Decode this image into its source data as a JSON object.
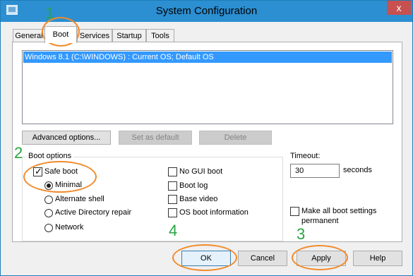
{
  "window": {
    "title": "System Configuration",
    "close_glyph": "x"
  },
  "tabs": [
    {
      "label": "General",
      "active": false
    },
    {
      "label": "Boot",
      "active": true
    },
    {
      "label": "Services",
      "active": false
    },
    {
      "label": "Startup",
      "active": false
    },
    {
      "label": "Tools",
      "active": false
    }
  ],
  "os_list": {
    "items": [
      "Windows 8.1 (C:\\WINDOWS) : Current OS; Default OS"
    ]
  },
  "os_buttons": {
    "advanced": "Advanced options...",
    "set_default": "Set as default",
    "delete": "Delete"
  },
  "boot_options": {
    "label": "Boot options",
    "safe_boot": "Safe boot",
    "minimal": "Minimal",
    "alternate_shell": "Alternate shell",
    "ad_repair": "Active Directory repair",
    "network": "Network",
    "no_gui": "No GUI boot",
    "boot_log": "Boot log",
    "base_video": "Base video",
    "os_boot_info": "OS boot information"
  },
  "timeout": {
    "label": "Timeout:",
    "value": "30",
    "units": "seconds"
  },
  "permanent": {
    "line1": "Make all boot settings",
    "line2": "permanent"
  },
  "footer": {
    "ok": "OK",
    "cancel": "Cancel",
    "apply": "Apply",
    "help": "Help"
  },
  "annotations": {
    "n1": "1",
    "n2": "2",
    "n3": "3",
    "n4": "4"
  },
  "colors": {
    "titlebar": "#2b8fd1",
    "selection": "#3399ff",
    "annotation_number": "#26a641",
    "annotation_oval": "#f28a2b",
    "close_button": "#c75050"
  }
}
